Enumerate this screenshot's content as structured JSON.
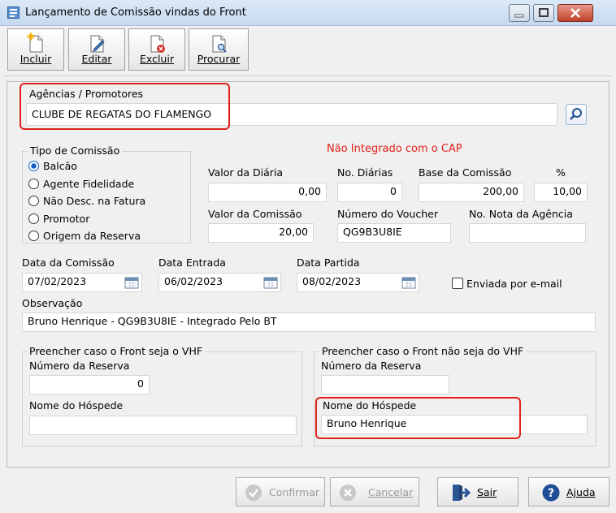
{
  "window": {
    "title": "Lançamento de Comissão vindas do Front"
  },
  "toolbar": {
    "incluir": "Incluir",
    "editar": "Editar",
    "excluir": "Excluir",
    "procurar": "Procurar"
  },
  "agencias": {
    "label": "Agências  / Promotores",
    "value": "CLUBE DE REGATAS DO FLAMENGO"
  },
  "status": {
    "text": "Não Integrado com o CAP",
    "color": "#e0211b"
  },
  "tipo_comissao": {
    "title": "Tipo de Comissão",
    "options": [
      "Balcão",
      "Agente Fidelidade",
      "Não Desc. na Fatura",
      "Promotor",
      "Origem da Reserva"
    ],
    "selected": "Balcão"
  },
  "valores": {
    "valor_diaria_label": "Valor da Diária",
    "valor_diaria": "0,00",
    "no_diarias_label": "No. Diárias",
    "no_diarias": "0",
    "base_comissao_label": "Base da Comissão",
    "base_comissao": "200,00",
    "percent_label": "%",
    "percent": "10,00",
    "valor_comissao_label": "Valor da Comissão",
    "valor_comissao": "20,00",
    "numero_voucher_label": "Número do Voucher",
    "numero_voucher": "QG9B3U8IE",
    "nota_agencia_label": "No. Nota da Agência",
    "nota_agencia": ""
  },
  "datas": {
    "comissao_label": "Data da Comissão",
    "comissao": "07/02/2023",
    "entrada_label": "Data Entrada",
    "entrada": "06/02/2023",
    "partida_label": "Data Partida",
    "partida": "08/02/2023"
  },
  "enviada_email": {
    "label": "Enviada por e-mail",
    "checked": false
  },
  "observacao": {
    "label": "Observação",
    "value": "Bruno Henrique - QG9B3U8IE -  Integrado Pelo BT"
  },
  "vhf": {
    "title": "Preencher caso o Front seja o VHF",
    "numero_reserva_label": "Número da Reserva",
    "numero_reserva": "0",
    "nome_hospede_label": "Nome do Hóspede",
    "nome_hospede": ""
  },
  "nao_vhf": {
    "title": "Preencher caso o Front não seja do VHF",
    "numero_reserva_label": "Número da Reserva",
    "numero_reserva": "",
    "nome_hospede_label": "Nome do Hóspede",
    "nome_hospede": "Bruno Henrique"
  },
  "buttons": {
    "confirmar": "Confirmar",
    "cancelar": "Cancelar",
    "sair": "Sair",
    "ajuda": "Ajuda"
  },
  "icons": {
    "app": "app-form-icon",
    "incluir": "new-document-icon",
    "editar": "edit-document-icon",
    "excluir": "delete-document-icon",
    "procurar": "search-document-icon",
    "search": "search-icon",
    "calendar": "calendar-icon",
    "confirmar": "check-circle-icon",
    "cancelar": "x-circle-icon",
    "sair": "exit-icon",
    "ajuda": "help-icon"
  }
}
